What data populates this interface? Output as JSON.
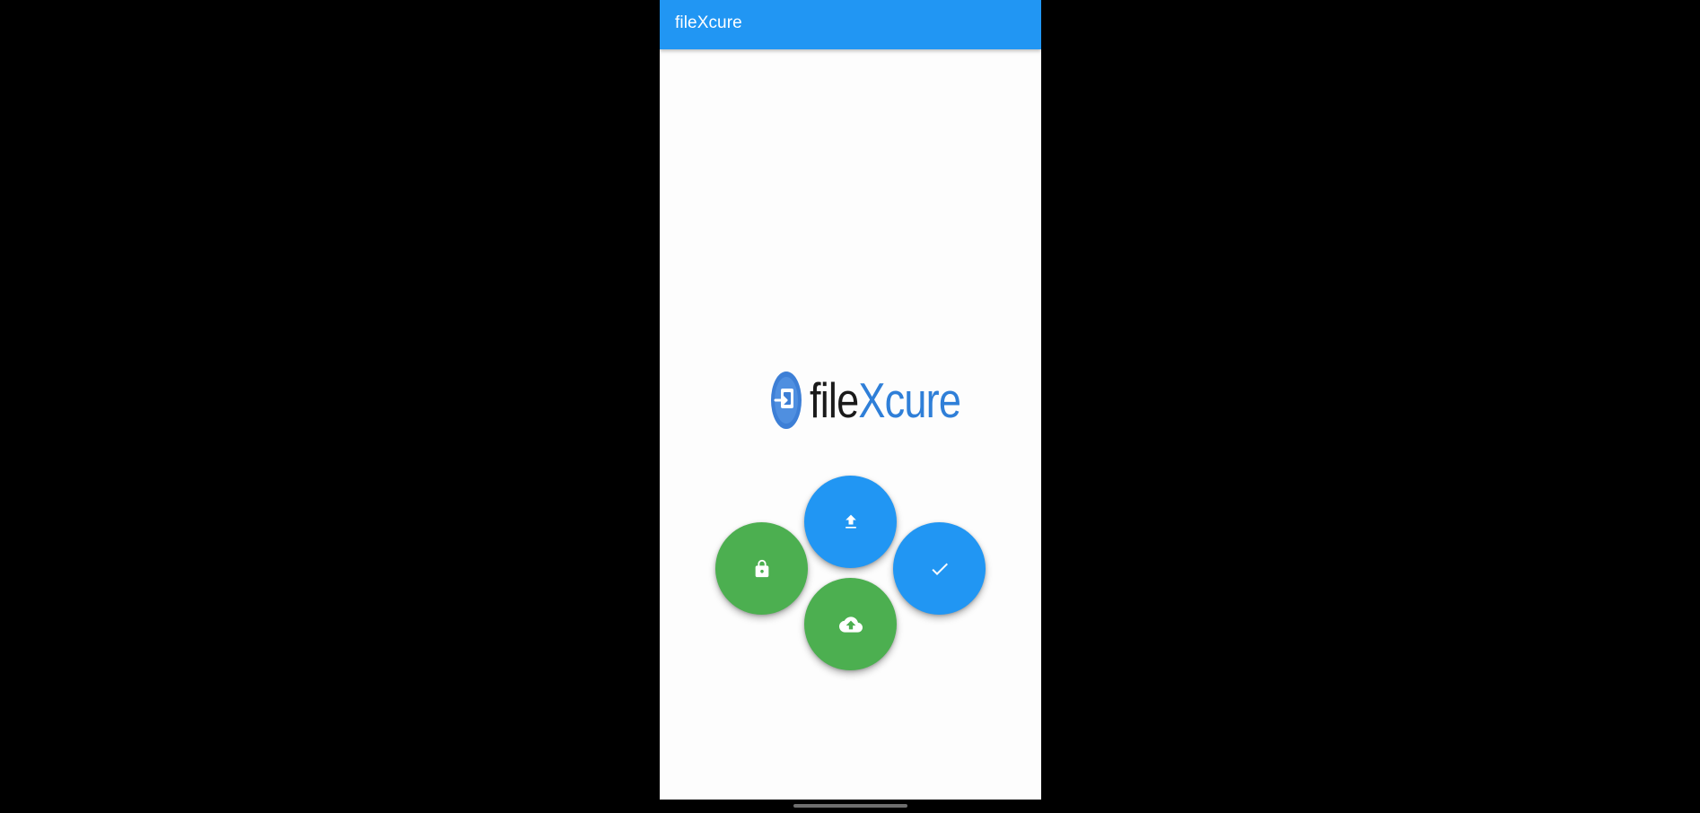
{
  "app": {
    "title": "fileXcure"
  },
  "logo": {
    "text_part1": "file",
    "text_part2": "Xcure",
    "icon": "file-transfer-logo-icon"
  },
  "actions": [
    {
      "id": "upload",
      "icon": "upload-icon",
      "color": "#2196f3"
    },
    {
      "id": "lock",
      "icon": "lock-icon",
      "color": "#4caf50"
    },
    {
      "id": "verify",
      "icon": "check-icon",
      "color": "#2196f3"
    },
    {
      "id": "cloud-upload",
      "icon": "cloud-upload-icon",
      "color": "#4caf50"
    }
  ],
  "colors": {
    "primary": "#2196f3",
    "secondary": "#4caf50",
    "logo_dark": "#1a1a1a",
    "logo_blue": "#2f7fd8"
  }
}
